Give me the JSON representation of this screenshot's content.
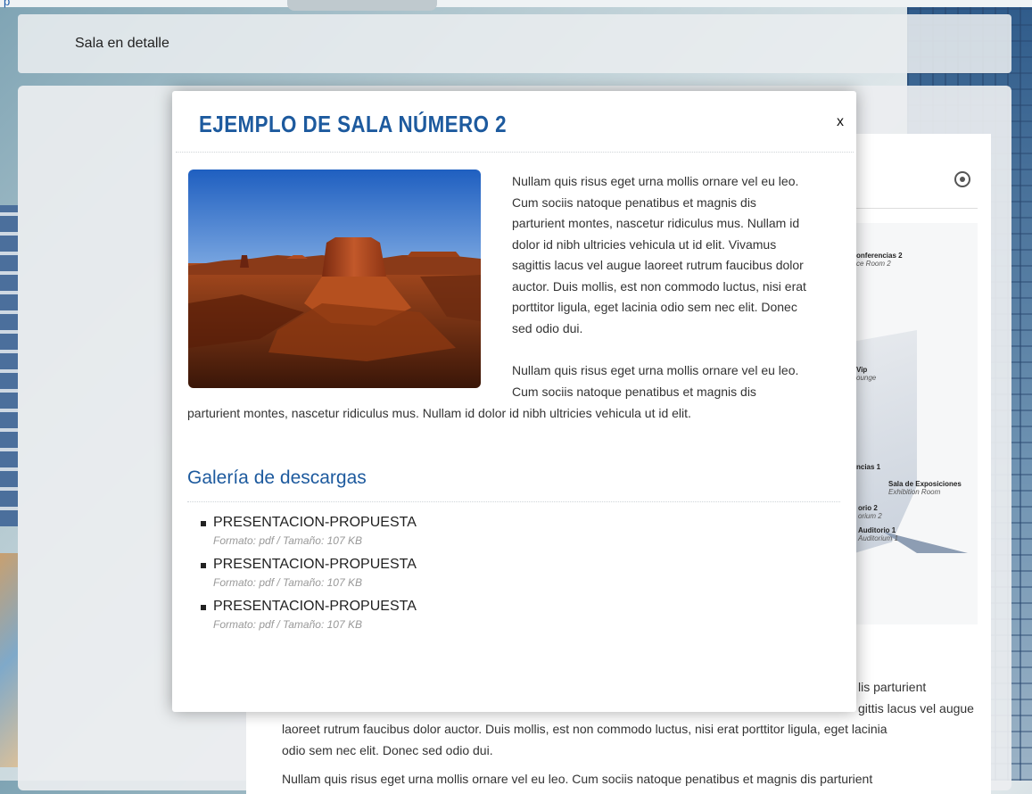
{
  "background": {
    "top_link": "p",
    "header_title": "Sala en detalle",
    "text_lines": [
      "laoreet rutrum faucibus dolor auctor. Duis mollis, est non commodo luctus, nisi erat porttitor ligula, eget lacinia",
      "odio sem nec elit. Donec sed odio dui.",
      "Nullam quis risus eget urna mollis ornare vel eu leo. Cum sociis natoque penatibus et magnis dis parturient"
    ],
    "right_fragments": [
      "lis parturient",
      "gittis lacus vel augue"
    ],
    "map_labels": [
      {
        "main": "onferencias 2",
        "sub": "ce Room 2"
      },
      {
        "main": "Vip",
        "sub": "ounge"
      },
      {
        "main": "ncias 1",
        "sub": ""
      },
      {
        "main": "Sala de Exposiciones",
        "sub": "Exhibition Room"
      },
      {
        "main": "orio 2",
        "sub": "orium 2"
      },
      {
        "main": "Auditorio 1",
        "sub": "Auditorium 1"
      }
    ]
  },
  "modal": {
    "title": "EJEMPLO DE SALA NÚMERO 2",
    "close_label": "x",
    "paragraph1_lines": [
      "Nullam quis risus eget urna mollis ornare vel eu leo.",
      "Cum sociis natoque penatibus et magnis dis",
      "parturient montes, nascetur ridiculus mus. Nullam id",
      "dolor id nibh ultricies vehicula ut id elit. Vivamus",
      "sagittis lacus vel augue laoreet rutrum faucibus dolor",
      "auctor. Duis mollis, est non commodo luctus, nisi erat",
      "porttitor ligula, eget lacinia odio sem nec elit. Donec",
      "sed odio dui."
    ],
    "paragraph2_lines": [
      "Nullam quis risus eget urna mollis ornare vel eu leo.",
      "Cum sociis natoque penatibus et magnis dis"
    ],
    "paragraph2_full_line": "parturient montes, nascetur ridiculus mus. Nullam id dolor id nibh ultricies vehicula ut id elit.",
    "gallery_title": "Galería de descargas",
    "downloads": [
      {
        "name": "PRESENTACION-PROPUESTA",
        "meta": "Formato: pdf  /  Tamaño: 107 KB"
      },
      {
        "name": "PRESENTACION-PROPUESTA",
        "meta": "Formato: pdf  /  Tamaño: 107 KB"
      },
      {
        "name": "PRESENTACION-PROPUESTA",
        "meta": "Formato: pdf  /  Tamaño: 107 KB"
      }
    ]
  },
  "colors": {
    "accent": "#1d5a9e",
    "meta_text": "#999999"
  },
  "icons": [
    "target-icon",
    "bullet-icon"
  ]
}
